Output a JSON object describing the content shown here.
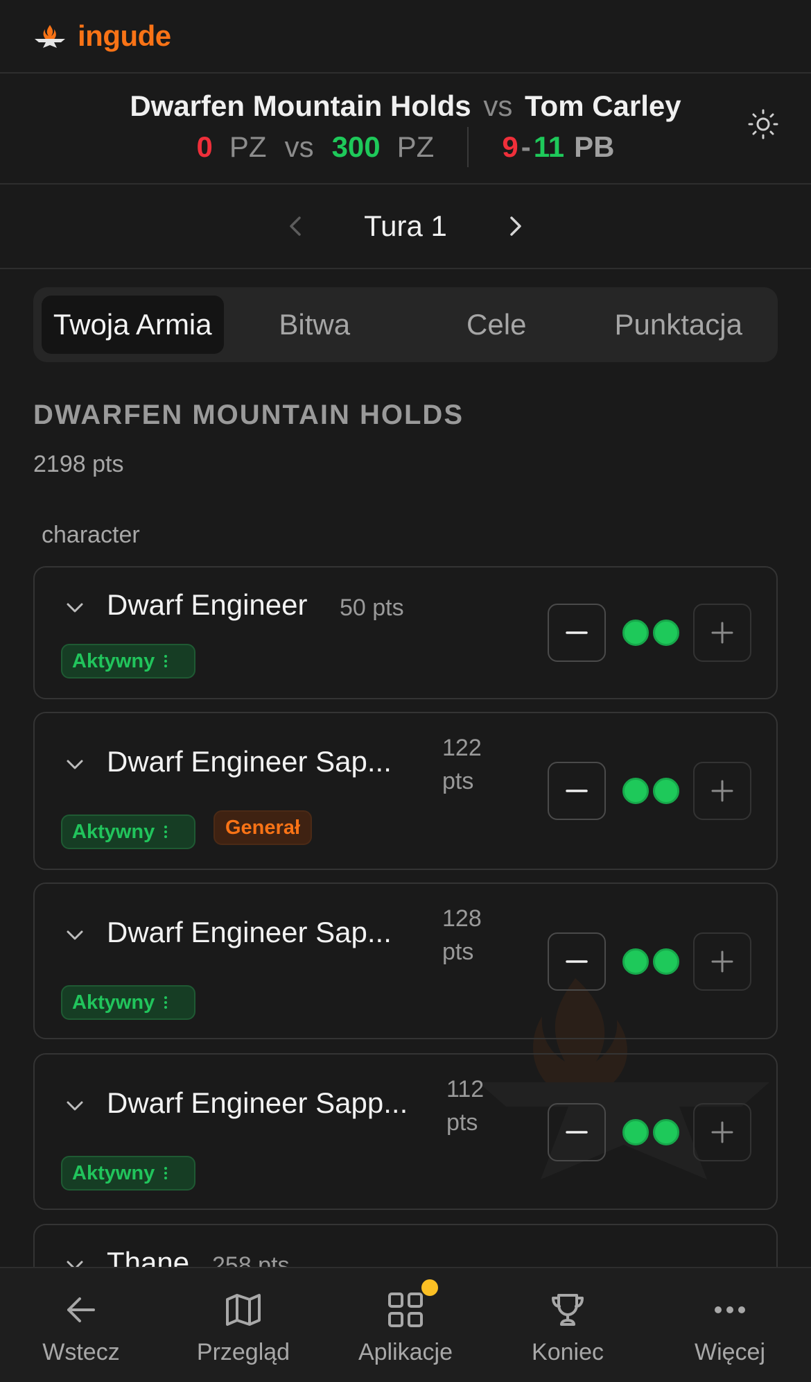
{
  "app": {
    "brand": "ingude",
    "brand_color": "#f97316"
  },
  "match": {
    "player_army": "Dwarfen Mountain Holds",
    "vs": "vs",
    "opponent": "Tom Carley",
    "score_left": "0",
    "score_left_unit": "PZ",
    "score_vs": "vs",
    "score_right": "300",
    "score_right_unit": "PZ",
    "pb_left": "9",
    "pb_dash": "-",
    "pb_right": "11",
    "pb_unit": "PB"
  },
  "round": {
    "label": "Tura 1"
  },
  "tabs": [
    "Twoja Armia",
    "Bitwa",
    "Cele",
    "Punktacja"
  ],
  "army": {
    "title": "DWARFEN MOUNTAIN HOLDS",
    "points": "2198 pts",
    "section": "character"
  },
  "units": [
    {
      "name": "Dwarf Engineer",
      "pts": "50 pts",
      "badges": [
        "Aktywny"
      ],
      "pips": 2
    },
    {
      "name": "Dwarf Engineer Sap...",
      "pts_line1": "122",
      "pts_line2": "pts",
      "badges": [
        "Aktywny",
        "Generał"
      ],
      "pips": 2
    },
    {
      "name": "Dwarf Engineer Sap...",
      "pts_line1": "128",
      "pts_line2": "pts",
      "badges": [
        "Aktywny"
      ],
      "pips": 2
    },
    {
      "name": "Dwarf Engineer Sapp...",
      "pts_line1": "112",
      "pts_line2": "pts",
      "badges": [
        "Aktywny"
      ],
      "pips": 2
    },
    {
      "name": "Thane",
      "pts": "258 pts"
    }
  ],
  "bottom_nav": [
    {
      "label": "Wstecz",
      "icon": "arrow-left-icon"
    },
    {
      "label": "Przegląd",
      "icon": "map-icon"
    },
    {
      "label": "Aplikacje",
      "icon": "grid-icon",
      "has_notification": true
    },
    {
      "label": "Koniec",
      "icon": "trophy-icon"
    },
    {
      "label": "Więcej",
      "icon": "more-icon"
    }
  ],
  "colors": {
    "active_green": "#21c45c",
    "general_orange": "#f97316",
    "score_red": "#ef2f3a",
    "score_green": "#1ec95a"
  }
}
